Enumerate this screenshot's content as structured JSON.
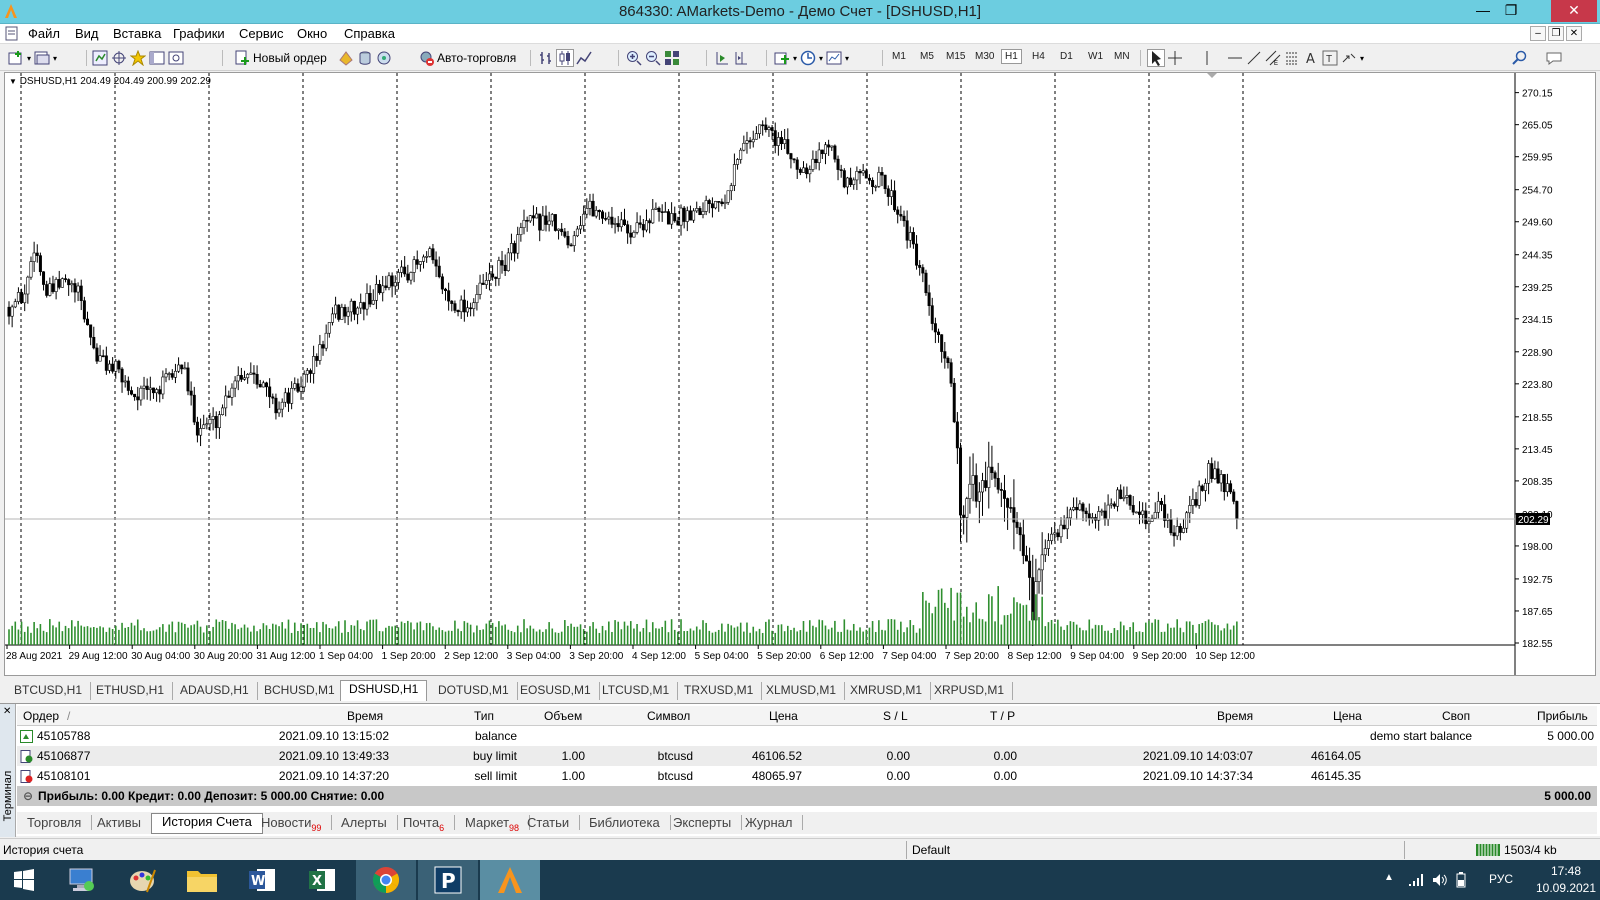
{
  "window": {
    "title": "864330: AMarkets-Demo - Демо Счет - [DSHUSD,H1]"
  },
  "menu": [
    "Файл",
    "Вид",
    "Вставка",
    "Графики",
    "Сервис",
    "Окно",
    "Справка"
  ],
  "toolbar": {
    "new_order": "Новый ордер",
    "autotrade": "Авто-торговля",
    "timeframes": [
      "M1",
      "M5",
      "M15",
      "M30",
      "H1",
      "H4",
      "D1",
      "W1",
      "MN"
    ],
    "active_tf": "H1"
  },
  "chart": {
    "symbol_info": "DSHUSD,H1  204.49 204.49 200.99 202.29",
    "current_price": "202.29"
  },
  "chart_data": {
    "type": "candlestick",
    "symbol": "DSHUSD,H1",
    "y_ticks": [
      270.15,
      265.05,
      259.95,
      254.7,
      249.6,
      244.35,
      239.25,
      234.15,
      228.9,
      223.8,
      218.55,
      213.45,
      208.35,
      203.1,
      198.0,
      192.75,
      187.65,
      182.55
    ],
    "ylim": [
      182.55,
      272
    ],
    "x_ticks": [
      "28 Aug 2021",
      "29 Aug 12:00",
      "30 Aug 04:00",
      "30 Aug 20:00",
      "31 Aug 12:00",
      "1 Sep 04:00",
      "1 Sep 20:00",
      "2 Sep 12:00",
      "3 Sep 04:00",
      "3 Sep 20:00",
      "4 Sep 12:00",
      "5 Sep 04:00",
      "5 Sep 20:00",
      "6 Sep 12:00",
      "7 Sep 04:00",
      "7 Sep 20:00",
      "8 Sep 12:00",
      "9 Sep 04:00",
      "9 Sep 20:00",
      "10 Sep 12:00"
    ],
    "price_path": [
      [
        0,
        236
      ],
      [
        5,
        238
      ],
      [
        8,
        246
      ],
      [
        12,
        238
      ],
      [
        18,
        240
      ],
      [
        22,
        238
      ],
      [
        28,
        228
      ],
      [
        34,
        226
      ],
      [
        40,
        222
      ],
      [
        48,
        223
      ],
      [
        55,
        227
      ],
      [
        60,
        217
      ],
      [
        66,
        218
      ],
      [
        72,
        225
      ],
      [
        78,
        226
      ],
      [
        85,
        220
      ],
      [
        92,
        223
      ],
      [
        98,
        228
      ],
      [
        104,
        235
      ],
      [
        112,
        236
      ],
      [
        120,
        240
      ],
      [
        128,
        242
      ],
      [
        134,
        244
      ],
      [
        140,
        237
      ],
      [
        146,
        236
      ],
      [
        152,
        240
      ],
      [
        158,
        243
      ],
      [
        164,
        249
      ],
      [
        172,
        250
      ],
      [
        178,
        246
      ],
      [
        184,
        252
      ],
      [
        192,
        250
      ],
      [
        198,
        248
      ],
      [
        206,
        251
      ],
      [
        212,
        250
      ],
      [
        220,
        252
      ],
      [
        228,
        254
      ],
      [
        234,
        262
      ],
      [
        240,
        265
      ],
      [
        246,
        262
      ],
      [
        252,
        258
      ],
      [
        258,
        260
      ],
      [
        262,
        263
      ],
      [
        266,
        255
      ],
      [
        272,
        257
      ],
      [
        278,
        256
      ],
      [
        284,
        251
      ],
      [
        290,
        242
      ],
      [
        295,
        232
      ],
      [
        300,
        225
      ],
      [
        303,
        205
      ],
      [
        308,
        207
      ],
      [
        314,
        211
      ],
      [
        318,
        205
      ],
      [
        322,
        200
      ],
      [
        324,
        192
      ],
      [
        326,
        188
      ],
      [
        330,
        198
      ],
      [
        336,
        202
      ],
      [
        342,
        204
      ],
      [
        348,
        203
      ],
      [
        354,
        206
      ],
      [
        360,
        202
      ],
      [
        366,
        204
      ],
      [
        372,
        200
      ],
      [
        378,
        205
      ],
      [
        382,
        210
      ],
      [
        386,
        209
      ],
      [
        390,
        204
      ],
      [
        392,
        202
      ]
    ],
    "last_price": 202.29
  },
  "chart_tabs": [
    "BTCUSD,H1",
    "ETHUSD,H1",
    "ADAUSD,H1",
    "BCHUSD,M1",
    "DSHUSD,H1",
    "DOTUSD,M1",
    "EOSUSD,M1",
    "LTCUSD,M1",
    "TRXUSD,M1",
    "XLMUSD,M1",
    "XMRUSD,M1",
    "XRPUSD,M1"
  ],
  "active_chart_tab": "DSHUSD,H1",
  "history": {
    "columns": [
      "Ордер",
      "/",
      "Время",
      "Тип",
      "Объем",
      "Символ",
      "Цена",
      "S / L",
      "T / P",
      "Время",
      "Цена",
      "Своп",
      "Прибыль"
    ],
    "rows": [
      {
        "order": "45105788",
        "time": "2021.09.10 13:15:02",
        "type": "balance",
        "volume": "",
        "symbol": "",
        "price": "",
        "sl": "",
        "tp": "",
        "time2": "",
        "price2": "",
        "swap": "demo start balance",
        "profit": "5 000.00"
      },
      {
        "order": "45106877",
        "time": "2021.09.10 13:49:33",
        "type": "buy limit",
        "volume": "1.00",
        "symbol": "btcusd",
        "price": "46106.52",
        "sl": "0.00",
        "tp": "0.00",
        "time2": "2021.09.10 14:03:07",
        "price2": "46164.05",
        "swap": "",
        "profit": ""
      },
      {
        "order": "45108101",
        "time": "2021.09.10 14:37:20",
        "type": "sell limit",
        "volume": "1.00",
        "symbol": "btcusd",
        "price": "48065.97",
        "sl": "0.00",
        "tp": "0.00",
        "time2": "2021.09.10 14:37:34",
        "price2": "46145.35",
        "swap": "",
        "profit": ""
      }
    ],
    "summary": "Прибыль: 0.00  Кредит: 0.00  Депозит: 5 000.00  Снятие: 0.00",
    "summary_total": "5 000.00"
  },
  "terminal_label": "Терминал",
  "bottom_tabs": [
    {
      "label": "Торговля",
      "badge": ""
    },
    {
      "label": "Активы",
      "badge": ""
    },
    {
      "label": "История Счета",
      "badge": ""
    },
    {
      "label": "Новости",
      "badge": "99"
    },
    {
      "label": "Алерты",
      "badge": ""
    },
    {
      "label": "Почта",
      "badge": "6"
    },
    {
      "label": "Маркет",
      "badge": "98"
    },
    {
      "label": "Статьи",
      "badge": ""
    },
    {
      "label": "Библиотека",
      "badge": ""
    },
    {
      "label": "Эксперты",
      "badge": ""
    },
    {
      "label": "Журнал",
      "badge": ""
    }
  ],
  "active_bottom_tab": "История Счета",
  "status": {
    "left": "История счета",
    "profile": "Default",
    "traffic": "1503/4 kb"
  },
  "tray": {
    "lang": "РУС",
    "time": "17:48",
    "date": "10.09.2021"
  },
  "colors": {
    "titlebar": "#6ccde0",
    "volume": "#2f8f2f",
    "taskbar": "#1a3a4e",
    "close": "#c7384a"
  }
}
